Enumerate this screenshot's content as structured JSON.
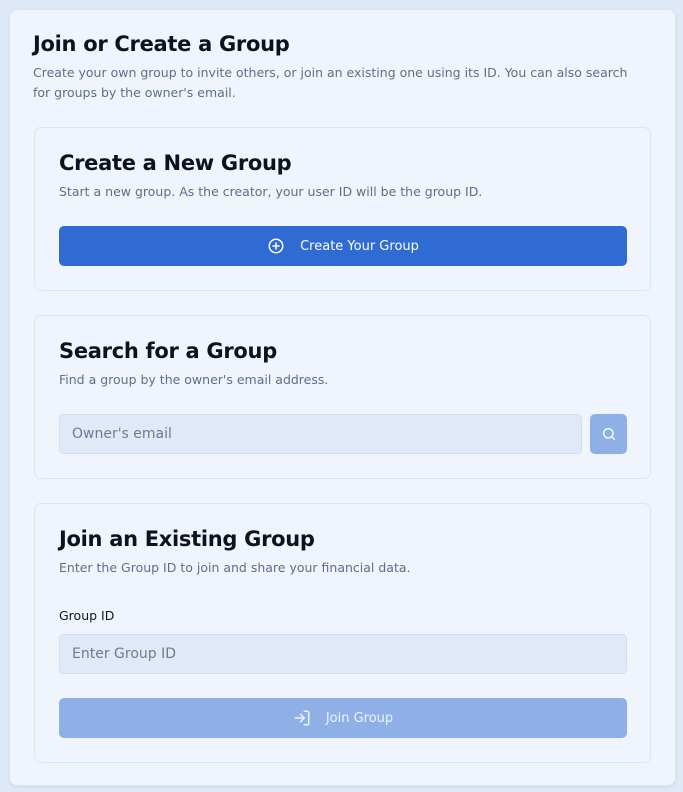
{
  "header": {
    "title": "Join or Create a Group",
    "description": "Create your own group to invite others, or join an existing one using its ID. You can also search for groups by the owner's email."
  },
  "create_card": {
    "title": "Create a New Group",
    "description": "Start a new group. As the creator, your user ID will be the group ID.",
    "button_label": "Create Your Group",
    "button_icon": "plus-circle-icon"
  },
  "search_card": {
    "title": "Search for a Group",
    "description": "Find a group by the owner's email address.",
    "input_placeholder": "Owner's email",
    "input_value": "",
    "button_icon": "search-icon"
  },
  "join_card": {
    "title": "Join an Existing Group",
    "description": "Enter the Group ID to join and share your financial data.",
    "field_label": "Group ID",
    "input_placeholder": "Enter Group ID",
    "input_value": "",
    "button_label": "Join Group",
    "button_icon": "log-in-icon",
    "button_disabled": true
  },
  "colors": {
    "primary": "#2f6bd3",
    "primary_disabled": "#8fb0e6",
    "surface": "#eff4fd",
    "input_bg": "#e0e9f8",
    "muted_text": "#5f6f86"
  }
}
